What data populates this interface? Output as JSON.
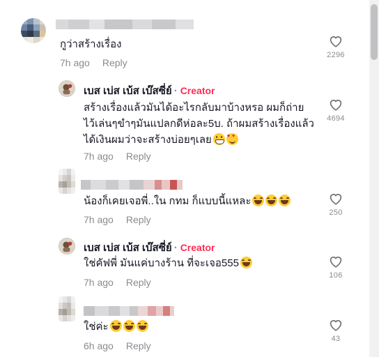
{
  "comments": [
    {
      "id": "c1",
      "username": "",
      "is_creator": false,
      "text": "กูว่าสร้างเรื่อง",
      "time": "7h ago",
      "reply_label": "Reply",
      "likes": "2296"
    },
    {
      "id": "c2",
      "username": "เบส เบ่ส เบ้ส เบ๊สซี่ย์",
      "is_creator": true,
      "creator_label": "Creator",
      "lines": [
        "สร้างเรื่องแล้วมันได้อะไรกลับมาบ้างหรอ ผมก็ถ่าย",
        "ไว้เล่นๆขำๆมันแปลกดีห่อละ5บ. ถ้าผมสร้างเรื่องแล้ว",
        "ได้เงินผมว่าจะสร้างบ่อยๆเลย"
      ],
      "time": "7h ago",
      "reply_label": "Reply",
      "likes": "4694"
    },
    {
      "id": "c3",
      "username": "",
      "is_creator": false,
      "text": "น้องก็เคยเจอพี่..ใน กทม ก็แบบนี้แหละ",
      "time": "7h ago",
      "reply_label": "Reply",
      "likes": "250"
    },
    {
      "id": "c4",
      "username": "เบส เบ่ส เบ้ส เบ๊สซี่ย์",
      "is_creator": true,
      "creator_label": "Creator",
      "text": "ใช่คัฟพี่ มันแค่บางร้าน ที่จะเจอ555",
      "time": "7h ago",
      "reply_label": "Reply",
      "likes": "106"
    },
    {
      "id": "c5",
      "username": "",
      "is_creator": false,
      "text": "ใช่ค่ะ",
      "time": "6h ago",
      "reply_label": "Reply",
      "likes": "43"
    }
  ],
  "colors": {
    "creator": "#fe2c55",
    "meta": "#8a8b91",
    "text": "#161823"
  },
  "icons": {
    "like": "heart-outline-icon",
    "emoji_laugh": "face-with-tears-of-joy-icon",
    "emoji_grin": "grinning-face-icon",
    "emoji_love": "smiling-face-with-hearts-icon"
  }
}
